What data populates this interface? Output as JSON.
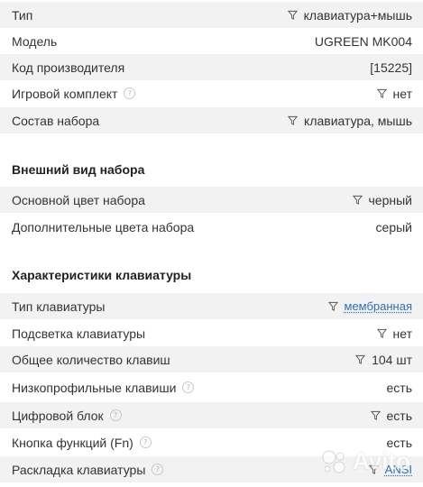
{
  "rows": [
    {
      "label": "Тип",
      "value": "клавиатура+мышь",
      "filter": true
    },
    {
      "label": "Модель",
      "value": "UGREEN MK004"
    },
    {
      "label": "Код производителя",
      "value": "[15225]"
    },
    {
      "label": "Игровой комплект",
      "value": "нет",
      "filter": true,
      "help": true
    },
    {
      "label": "Состав набора",
      "value": "клавиатура, мышь",
      "filter": true
    }
  ],
  "section_appearance": {
    "title": "Внешний вид набора",
    "rows": [
      {
        "label": "Основной цвет набора",
        "value": "черный",
        "filter": true
      },
      {
        "label": "Дополнительные цвета набора",
        "value": "серый"
      }
    ]
  },
  "section_keyboard": {
    "title": "Характеристики клавиатуры",
    "rows": [
      {
        "label": "Тип клавиатуры",
        "value": "мембранная",
        "filter": true,
        "link": true
      },
      {
        "label": "Подсветка клавиатуры",
        "value": "нет",
        "filter": true
      },
      {
        "label": "Общее количество клавиш",
        "value": "104 шт",
        "filter": true
      },
      {
        "label": "Низкопрофильные клавиши",
        "value": "есть",
        "help": true
      },
      {
        "label": "Цифровой блок",
        "value": "есть",
        "filter": true,
        "help": true
      },
      {
        "label": "Кнопка функций (Fn)",
        "value": "есть",
        "help": true
      },
      {
        "label": "Раскладка клавиатуры",
        "value": "ANSI",
        "filter": true,
        "help": true,
        "link": true
      }
    ]
  },
  "help_glyph": "?",
  "filter_icon": "funnel-icon",
  "colors": {
    "stripe": "#f2f2f2",
    "link": "#2f6fb3",
    "text": "#333333"
  },
  "watermark": {
    "brand": "Avito"
  }
}
